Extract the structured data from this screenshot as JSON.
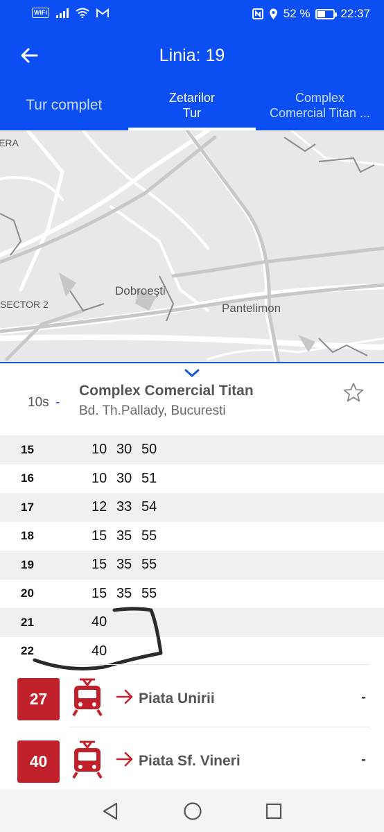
{
  "status_bar": {
    "wifi_badge": "WiFi",
    "carrier_icons": "signal wifi gmail",
    "battery_text": "52 %",
    "battery_level": 0.52,
    "time": "22:37"
  },
  "app_bar": {
    "title": "Linia: 19",
    "back_icon": "arrow-left-icon"
  },
  "tabs": [
    {
      "line1": "Tur complet",
      "line2": ""
    },
    {
      "line1": "Zetarilor",
      "line2": "Tur"
    },
    {
      "line1": "Complex",
      "line2": "Comercial Titan ..."
    }
  ],
  "active_tab": 1,
  "map": {
    "labels": [
      "ERA",
      "SECTOR 2",
      "Dobroeşti",
      "Pantelimon"
    ]
  },
  "stop": {
    "frequency": "10s",
    "frequency_suffix": "-",
    "name": "Complex Comercial Titan",
    "address": "Bd. Th.Pallady, Bucuresti"
  },
  "schedule": [
    {
      "hour": "15",
      "minutes": [
        "10",
        "30",
        "50"
      ]
    },
    {
      "hour": "16",
      "minutes": [
        "10",
        "30",
        "51"
      ]
    },
    {
      "hour": "17",
      "minutes": [
        "12",
        "33",
        "54"
      ]
    },
    {
      "hour": "18",
      "minutes": [
        "15",
        "35",
        "55"
      ]
    },
    {
      "hour": "19",
      "minutes": [
        "15",
        "35",
        "55"
      ]
    },
    {
      "hour": "20",
      "minutes": [
        "15",
        "35",
        "55"
      ]
    },
    {
      "hour": "21",
      "minutes": [
        "40"
      ]
    },
    {
      "hour": "22",
      "minutes": [
        "40"
      ]
    }
  ],
  "routes": [
    {
      "number": "27",
      "destination": "Piata Unirii",
      "status": "-",
      "icon": "tram-icon"
    },
    {
      "number": "40",
      "destination": "Piata Sf. Vineri",
      "status": "-",
      "icon": "tram-icon"
    }
  ],
  "colors": {
    "primary_blue": "#0b4ff2",
    "route_red": "#c0202a",
    "row_shade": "#f0f0f0"
  }
}
